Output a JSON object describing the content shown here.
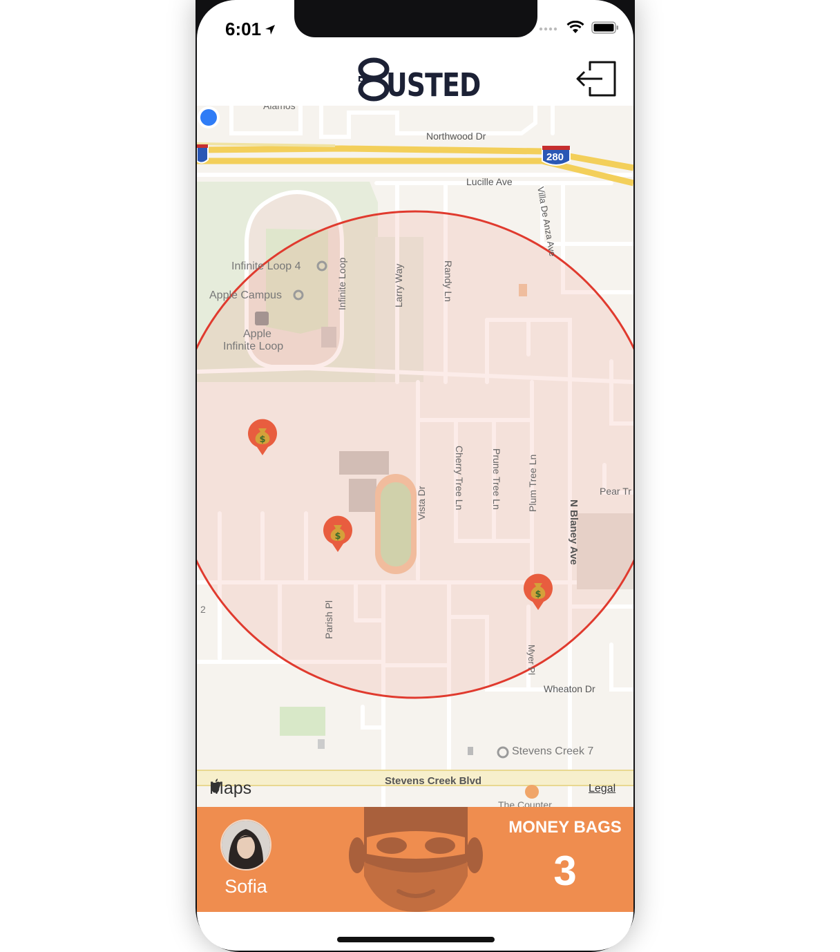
{
  "status_bar": {
    "time": "6:01"
  },
  "header": {
    "logo_text": "USTED",
    "logout_icon": "logout-icon"
  },
  "map": {
    "labels": {
      "northwood": "Northwood Dr",
      "i280": "280",
      "lucille": "Lucille Ave",
      "villa": "Villa De Anza Ave",
      "infinite_loop_4": "Infinite Loop 4",
      "apple_campus": "Apple Campus",
      "infinite_loop_street": "Infinite Loop",
      "larry": "Larry Way",
      "randy": "Randy Ln",
      "apple_infinite_loop_1": "Apple",
      "apple_infinite_loop_2": "Infinite Loop",
      "vista": "Vista Dr",
      "cherry": "Cherry Tree Ln",
      "prune": "Prune Tree Ln",
      "plum": "Plum Tree Ln",
      "blaney": "N Blaney Ave",
      "pear": "Pear Tr",
      "parish": "Parish Pl",
      "myer": "Myer Pl",
      "wheaton": "Wheaton Dr",
      "stevens_creek_7": "Stevens Creek 7",
      "stevens_creek_blvd": "Stevens Creek Blvd",
      "counter": "The Counter",
      "number_2": "2",
      "alamos": "Alamos"
    },
    "brand": "Maps",
    "legal": "Legal",
    "pin_icon": "money-bag-icon"
  },
  "bottom_bar": {
    "username": "Sofia",
    "money_bags_label": "MONEY BAGS",
    "money_bags_count": "3"
  },
  "colors": {
    "accent": "#ef8d4f",
    "circle": "#e03a2e",
    "pin": "#e85d3f",
    "user_dot": "#2f7cf6"
  }
}
